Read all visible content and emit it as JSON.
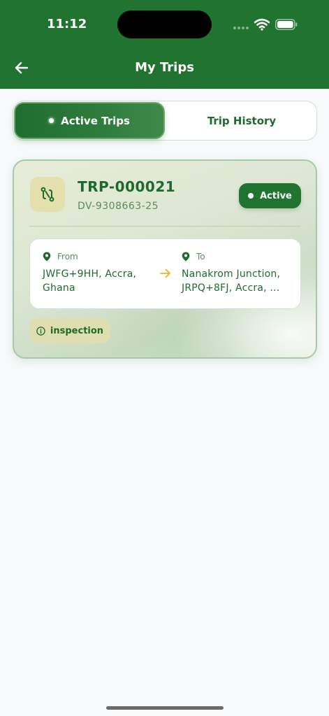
{
  "status_bar": {
    "time": "11:12"
  },
  "header": {
    "title": "My Trips"
  },
  "tabs": [
    {
      "label": "Active Trips",
      "active": true
    },
    {
      "label": "Trip History",
      "active": false
    }
  ],
  "trip": {
    "id": "TRP-000021",
    "vehicle": "DV-9308663-25",
    "status": "Active",
    "from_label": "From",
    "from_value": "JWFG+9HH, Accra, Ghana",
    "to_label": "To",
    "to_value": "Nanakrom Junction, JRPQ+8FJ, Accra, ...",
    "tag": "inspection"
  },
  "icons": {
    "back": "arrow-left-icon",
    "route": "route-icon",
    "pin": "map-pin-icon",
    "arrow": "arrow-right-icon",
    "info": "info-icon"
  },
  "colors": {
    "brand": "#217330",
    "accent_arrow": "#e8b62c",
    "text_green": "#1d6b2c"
  }
}
